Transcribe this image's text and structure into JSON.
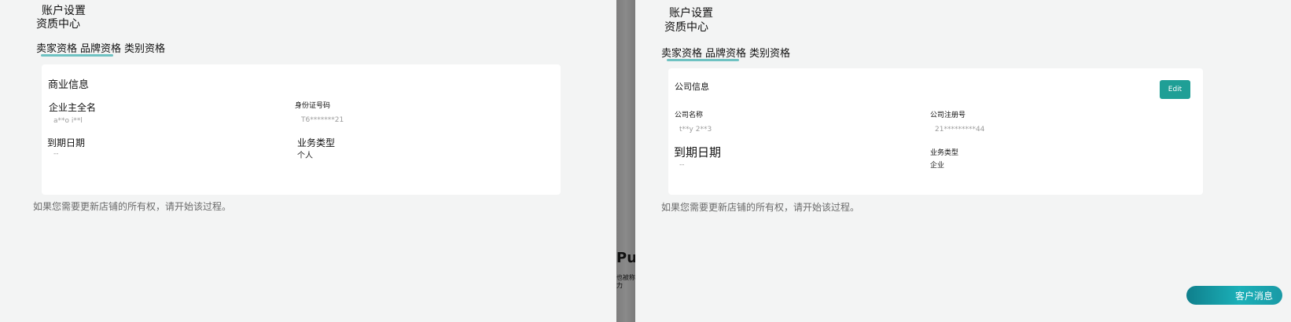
{
  "left": {
    "breadcrumb": "账户设置",
    "page_title": "资质中心",
    "tabs": [
      {
        "label": "卖家资格"
      },
      {
        "label": "品牌资格"
      },
      {
        "label": "类别资格"
      }
    ],
    "card": {
      "title": "商业信息",
      "fields": [
        {
          "label": "企业主全名",
          "value": "a**o i**l"
        },
        {
          "label": "身份证号码",
          "value": "T6*******21"
        },
        {
          "label": "到期日期",
          "value": "--"
        },
        {
          "label": "业务类型",
          "value": "个人"
        }
      ]
    },
    "note": "如果您需要更新店铺的所有权，请开始该过程。"
  },
  "divider": {
    "ghost_big": "Pus",
    "ghost_small_1": "也被称",
    "ghost_small_2": "力"
  },
  "right": {
    "breadcrumb": "账户设置",
    "page_title": "资质中心",
    "tabs": [
      {
        "label": "卖家资格"
      },
      {
        "label": "品牌资格"
      },
      {
        "label": "类别资格"
      }
    ],
    "card": {
      "title": "公司信息",
      "edit_label": "Edit",
      "fields": [
        {
          "label": "公司名称",
          "value": "t**y 2**3"
        },
        {
          "label": "公司注册号",
          "value": "21*********44"
        },
        {
          "label": "到期日期",
          "value": "--"
        },
        {
          "label": "业务类型",
          "value": "企业"
        }
      ]
    },
    "note": "如果您需要更新店铺的所有权，请开始该过程。",
    "chat_button": "客户消息"
  },
  "colors": {
    "accent": "#1f9f96",
    "tab_underline": "#6fc2c2",
    "background": "#f3f4f4",
    "card": "#ffffff"
  }
}
